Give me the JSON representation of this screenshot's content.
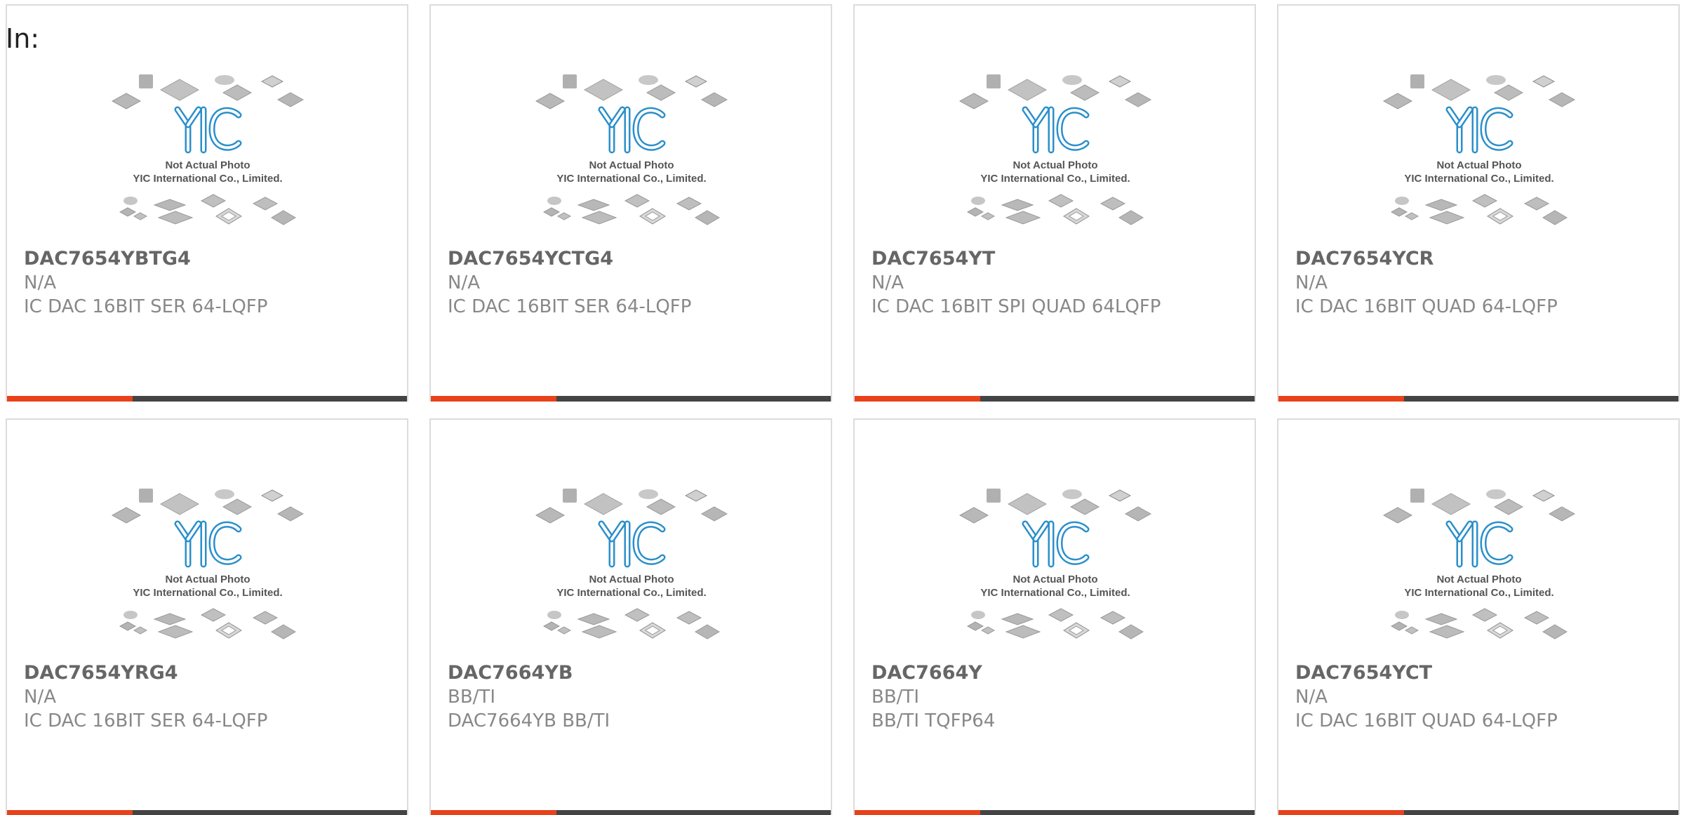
{
  "header": {
    "label": "In:"
  },
  "photo": {
    "caption_line1": "Not Actual Photo",
    "caption_line2": "YIC International Co., Limited.",
    "logo_text": "YIC",
    "logo_color": "#2b8fcb"
  },
  "colors": {
    "accent": "#e8411b",
    "bar": "#444444",
    "border": "#dcdcdc",
    "part_text": "#666666",
    "meta_text": "#888888"
  },
  "products": [
    {
      "part": "DAC7654YBTG4",
      "manufacturer": "N/A",
      "description": "IC DAC 16BIT SER 64-LQFP"
    },
    {
      "part": "DAC7654YCTG4",
      "manufacturer": "N/A",
      "description": "IC DAC 16BIT SER 64-LQFP"
    },
    {
      "part": "DAC7654YT",
      "manufacturer": "N/A",
      "description": "IC DAC 16BIT SPI QUAD 64LQFP"
    },
    {
      "part": "DAC7654YCR",
      "manufacturer": "N/A",
      "description": "IC DAC 16BIT QUAD 64-LQFP"
    },
    {
      "part": "DAC7654YRG4",
      "manufacturer": "N/A",
      "description": "IC DAC 16BIT SER 64-LQFP"
    },
    {
      "part": "DAC7664YB",
      "manufacturer": "BB/TI",
      "description": "DAC7664YB BB/TI"
    },
    {
      "part": "DAC7664Y",
      "manufacturer": "BB/TI",
      "description": "BB/TI TQFP64"
    },
    {
      "part": "DAC7654YCT",
      "manufacturer": "N/A",
      "description": "IC DAC 16BIT QUAD 64-LQFP"
    }
  ]
}
